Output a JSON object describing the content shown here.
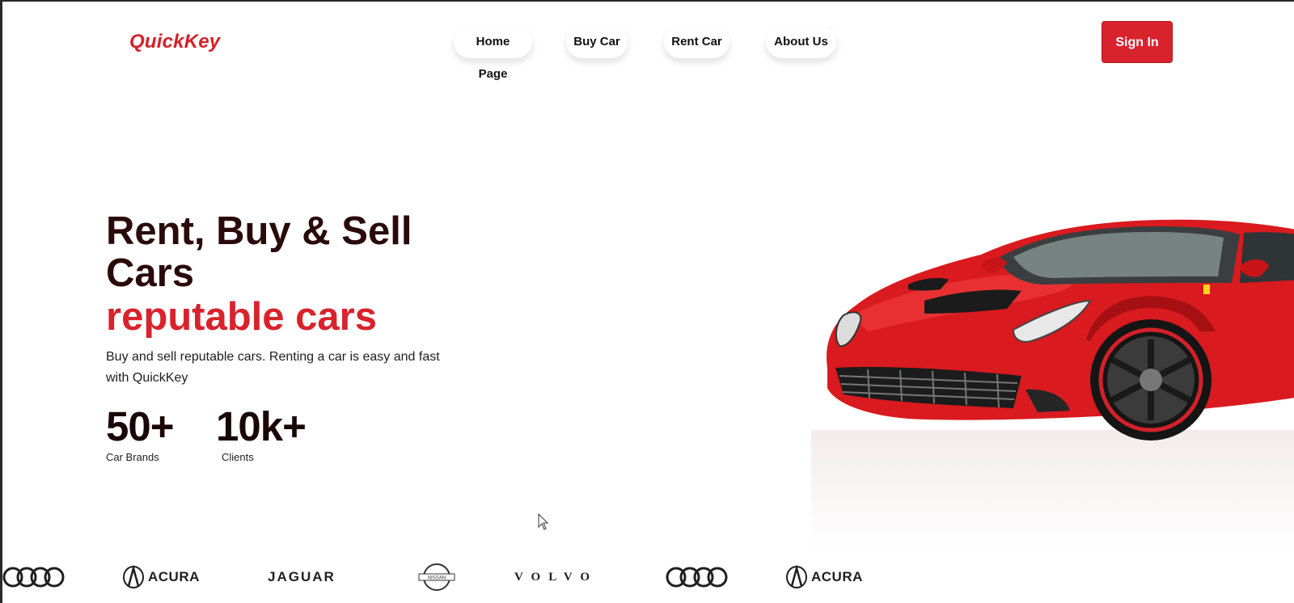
{
  "brand": {
    "name": "QuickKey"
  },
  "nav": {
    "items": [
      {
        "label": "Home Page"
      },
      {
        "label": "Buy Car"
      },
      {
        "label": "Rent Car"
      },
      {
        "label": "About Us"
      }
    ],
    "signin_label": "Sign In"
  },
  "hero": {
    "title": "Rent, Buy & Sell Cars",
    "accent": "reputable cars",
    "description": "Buy and sell reputable cars. Renting a car is easy and fast with QuickKey",
    "stats": [
      {
        "value": "50+",
        "label": "Car Brands"
      },
      {
        "value": "10k+",
        "label": "Clients"
      }
    ]
  },
  "logos": {
    "acura": "ACURA",
    "jaguar": "JAGUAR",
    "nissan": "NISSAN",
    "volvo": "VOLVO"
  },
  "colors": {
    "accent": "#d9232c",
    "title": "#2a0a0a"
  }
}
